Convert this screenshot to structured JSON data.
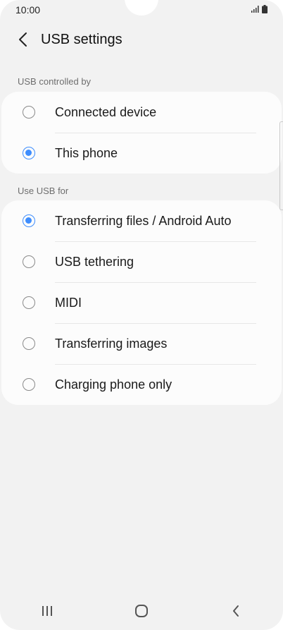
{
  "status_bar": {
    "time": "10:00",
    "icons": [
      "signal-icon",
      "battery-icon"
    ]
  },
  "toolbar": {
    "back_icon": "chevron-left-icon",
    "title": "USB settings"
  },
  "sections": [
    {
      "header": "USB controlled by",
      "options": [
        {
          "label": "Connected device",
          "selected": false
        },
        {
          "label": "This phone",
          "selected": true
        }
      ]
    },
    {
      "header": "Use USB for",
      "options": [
        {
          "label": "Transferring files / Android Auto",
          "selected": true
        },
        {
          "label": "USB tethering",
          "selected": false
        },
        {
          "label": "MIDI",
          "selected": false
        },
        {
          "label": "Transferring images",
          "selected": false
        },
        {
          "label": "Charging phone only",
          "selected": false
        }
      ]
    }
  ],
  "navigation_bar": {
    "buttons": [
      "recent-apps-icon",
      "home-icon",
      "back-icon"
    ]
  },
  "colors": {
    "accent": "#3e8dfd",
    "background": "#f2f2f2",
    "card": "#fcfcfc"
  }
}
